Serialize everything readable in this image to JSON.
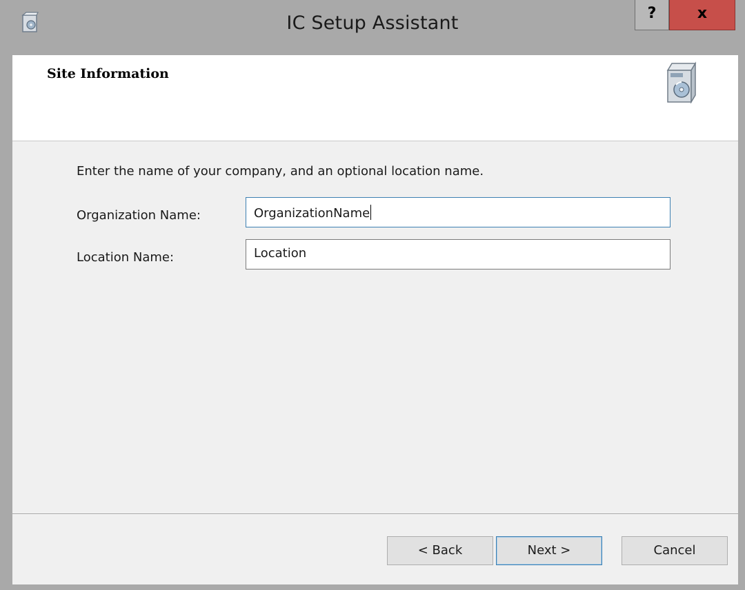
{
  "window": {
    "title": "IC Setup Assistant",
    "help_label": "?",
    "close_label": "x"
  },
  "header": {
    "title": "Site Information"
  },
  "form": {
    "instructions": "Enter the name of your company, and an optional location name.",
    "organization_label": "Organization Name:",
    "organization_value": "OrganizationName",
    "location_label": "Location Name:",
    "location_value": "Location"
  },
  "buttons": {
    "back": "< Back",
    "next": "Next >",
    "cancel": "Cancel"
  },
  "icons": {
    "app": "setup-box-icon",
    "header": "software-package-icon"
  },
  "colors": {
    "titlebar": "#a9a9a9",
    "close_button": "#c74f4a",
    "focus_border": "#3c7fb1",
    "dialog_background": "#f0f0f0"
  }
}
